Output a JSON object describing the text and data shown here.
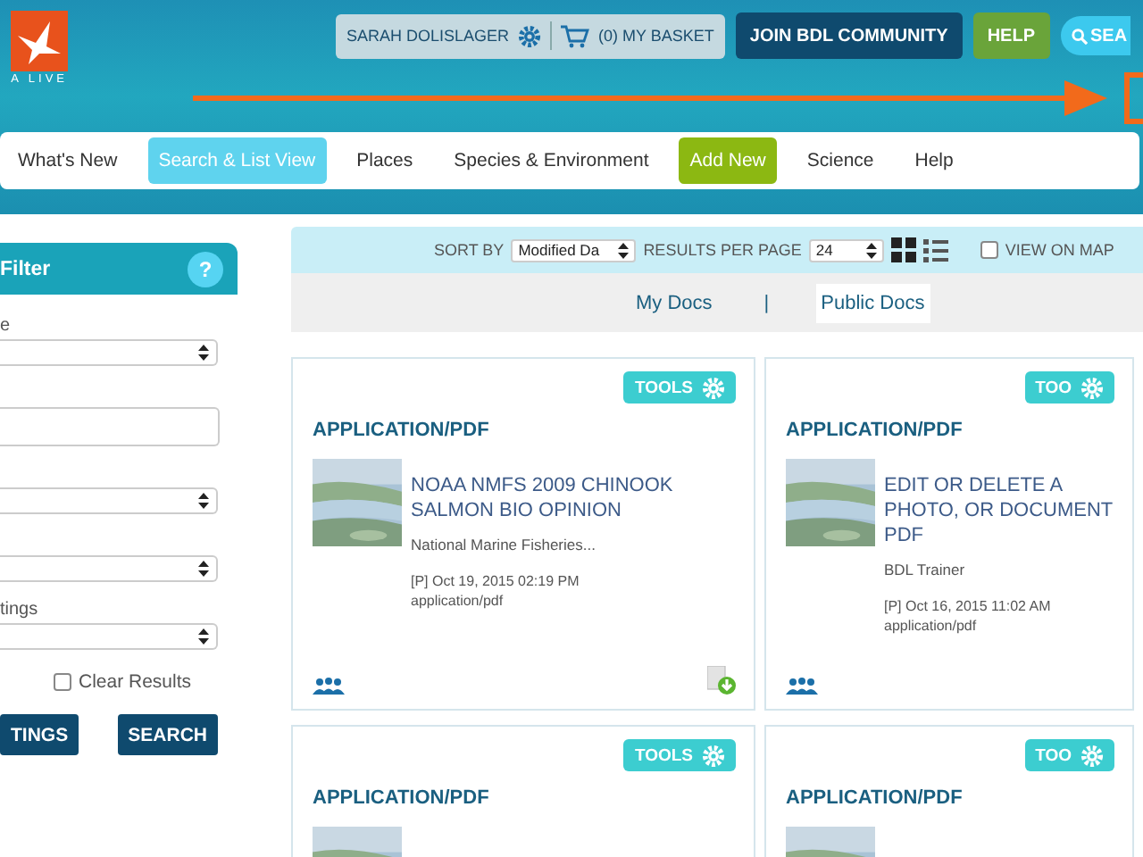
{
  "logo": {
    "text": "A LIVE"
  },
  "header": {
    "user": "SARAH DOLISLAGER",
    "basket": "(0) MY BASKET",
    "join": "JOIN BDL COMMUNITY",
    "help": "HELP",
    "search": "SEA"
  },
  "nav": [
    {
      "label": "What's New",
      "kind": "plain",
      "selected": false
    },
    {
      "label": "Search & List View",
      "kind": "plain",
      "selected": true
    },
    {
      "label": "Places",
      "kind": "plain",
      "selected": false
    },
    {
      "label": "Species & Environment",
      "kind": "plain",
      "selected": false
    },
    {
      "label": "Add New",
      "kind": "accent",
      "selected": false
    },
    {
      "label": "Science",
      "kind": "plain",
      "selected": false
    },
    {
      "label": "Help",
      "kind": "plain",
      "selected": false
    }
  ],
  "filter": {
    "title": "Filter",
    "help": "?",
    "fields": [
      {
        "kind": "select",
        "label": "e"
      },
      {
        "kind": "text"
      },
      {
        "kind": "select"
      },
      {
        "kind": "select"
      },
      {
        "kind": "select",
        "label": "tings"
      }
    ],
    "clear_results": {
      "label": "Clear Results",
      "checked": false
    },
    "buttons": [
      "TINGS",
      "SEARCH"
    ]
  },
  "toolbar": {
    "sort_label": "SORT BY",
    "sort_value": "Modified Da",
    "per_page_label": "RESULTS PER PAGE",
    "per_page_value": "24",
    "views": [
      {
        "kind": "grid",
        "selected": true
      },
      {
        "kind": "list",
        "selected": false
      }
    ],
    "view_on_map": {
      "label": "VIEW ON MAP",
      "checked": false
    }
  },
  "doc_tabs": [
    {
      "label": "My Docs",
      "selected": false
    },
    {
      "label": "Public Docs",
      "selected": true
    }
  ],
  "doc_tab_separator": "|",
  "cards": [
    {
      "tools": "TOOLS",
      "type": "APPLICATION/PDF",
      "title": "NOAA NMFS 2009 CHINOOK SALMON BIO OPINION",
      "author": "National Marine Fisheries...",
      "date": "[P] Oct 19, 2015 02:19 PM",
      "mime": "application/pdf",
      "download": true
    },
    {
      "tools": "TOO",
      "type": "APPLICATION/PDF",
      "title": "EDIT OR DELETE A PHOTO, OR DOCUMENT PDF",
      "author": "BDL Trainer",
      "date": "[P] Oct 16, 2015 11:02 AM",
      "mime": "application/pdf",
      "download": false
    },
    {
      "tools": "TOOLS",
      "type": "APPLICATION/PDF"
    },
    {
      "tools": "TOO",
      "type": "APPLICATION/PDF"
    }
  ]
}
